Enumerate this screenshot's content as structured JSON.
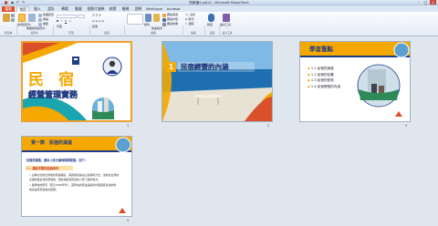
{
  "window": {
    "title": "簡報檔4.pptx2 - Microsoft PowerPoint"
  },
  "tabs": [
    "檔案",
    "常用",
    "插入",
    "設計",
    "轉場",
    "動畫",
    "投影片放映",
    "校閱",
    "檢視",
    "說明",
    "Mathtype",
    "Acrobat"
  ],
  "ribbon": {
    "new_slide": "新增投影片",
    "reuse": "重複使用投影片",
    "layout": "版面配置",
    "reset": "重設",
    "section": "章節",
    "font_btn": "字型",
    "paragraph_btn": "段落",
    "shape_fill": "圖案填滿",
    "outline": "圖案外框",
    "effect": "圖案效果",
    "quick_styles": "快速樣式",
    "arrange": "排列",
    "find": "尋找",
    "replace": "取代",
    "select": "選取",
    "dictate": "聽寫",
    "designer": "設計工具",
    "groups": [
      "剪貼簿",
      "投影片",
      "字型",
      "段落",
      "繪圖",
      "編輯",
      "語音",
      "設計工具"
    ]
  },
  "slides": [
    {
      "num": "1",
      "title_a": "民",
      "title_b": "宿",
      "subtitle": "經營管理實務"
    },
    {
      "num": "2",
      "badge": "1",
      "heading": "民宿經營的內涵"
    },
    {
      "num": "3",
      "heading": "學習重點",
      "bullets": [
        "1.1 民宿的演進",
        "1.2 民宿的定義",
        "1.3 民宿的型態",
        "1.4 民宿經營的內涵"
      ]
    },
    {
      "num": "4",
      "heading": "第一節　民宿的演進",
      "intro": "民宿的演進，基本上有五個時期與發展，如下：",
      "section": "一、源起早期的起始時代：",
      "para1": "這種北北當台灣地的民宿開館，其實當初是在山區裡有方法，也前在台灣地北邊的跟台灣的發展地，因為地區有民宿的人想了解的地方。",
      "para2": "與鄰地的所有（西元1980年代），其所在的民宿是提供外面遊客住宿的場地就是有旅遊者的需要。"
    }
  ],
  "colors": {
    "accent": "#f5a800",
    "brand": "#d9502b",
    "navy": "#1f3c88",
    "teal": "#1aa6b0"
  }
}
